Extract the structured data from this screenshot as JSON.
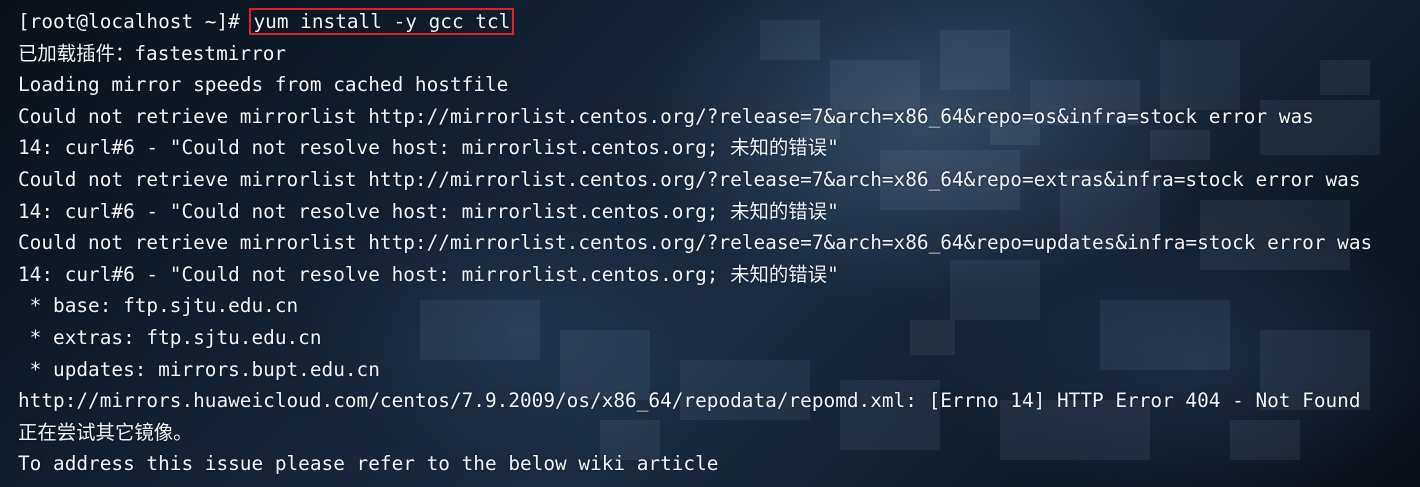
{
  "terminal": {
    "prompt": "[root@localhost ~]# ",
    "command": "yum install -y gcc tcl",
    "highlight_color": "#d8232a",
    "text_color": "#f2f4f7",
    "lines": [
      "已加载插件：fastestmirror",
      "Loading mirror speeds from cached hostfile",
      "Could not retrieve mirrorlist http://mirrorlist.centos.org/?release=7&arch=x86_64&repo=os&infra=stock error was",
      "14: curl#6 - \"Could not resolve host: mirrorlist.centos.org; 未知的错误\"",
      "Could not retrieve mirrorlist http://mirrorlist.centos.org/?release=7&arch=x86_64&repo=extras&infra=stock error was",
      "14: curl#6 - \"Could not resolve host: mirrorlist.centos.org; 未知的错误\"",
      "Could not retrieve mirrorlist http://mirrorlist.centos.org/?release=7&arch=x86_64&repo=updates&infra=stock error was",
      "14: curl#6 - \"Could not resolve host: mirrorlist.centos.org; 未知的错误\"",
      " * base: ftp.sjtu.edu.cn",
      " * extras: ftp.sjtu.edu.cn",
      " * updates: mirrors.bupt.edu.cn",
      "http://mirrors.huaweicloud.com/centos/7.9.2009/os/x86_64/repodata/repomd.xml: [Errno 14] HTTP Error 404 - Not Found",
      "正在尝试其它镜像。",
      "To address this issue please refer to the below wiki article"
    ]
  }
}
